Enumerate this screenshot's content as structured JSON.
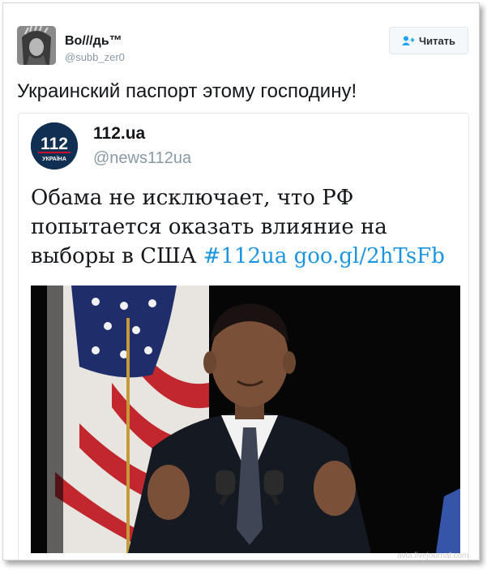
{
  "tweet": {
    "author_name": "Bo///дь™",
    "author_handle": "@subb_zer0",
    "follow_label": "Читать",
    "text": "Украинский паспорт этому господину!"
  },
  "quoted_tweet": {
    "author_name": "112.ua",
    "author_handle": "@news112ua",
    "logo_number": "112",
    "logo_caption": "УКРАЇНА",
    "text": "Обама не исключает, что РФ попытается оказать влияние на выборы в США",
    "hashtag": "#112ua",
    "link": "goo.gl/2hTsFb"
  },
  "watermark": "avta.livejournal.com",
  "colors": {
    "link": "#1b95e0",
    "handle": "#8899a6",
    "logo_bg": "#112e53"
  },
  "icons": {
    "follow": "add-user-icon"
  }
}
